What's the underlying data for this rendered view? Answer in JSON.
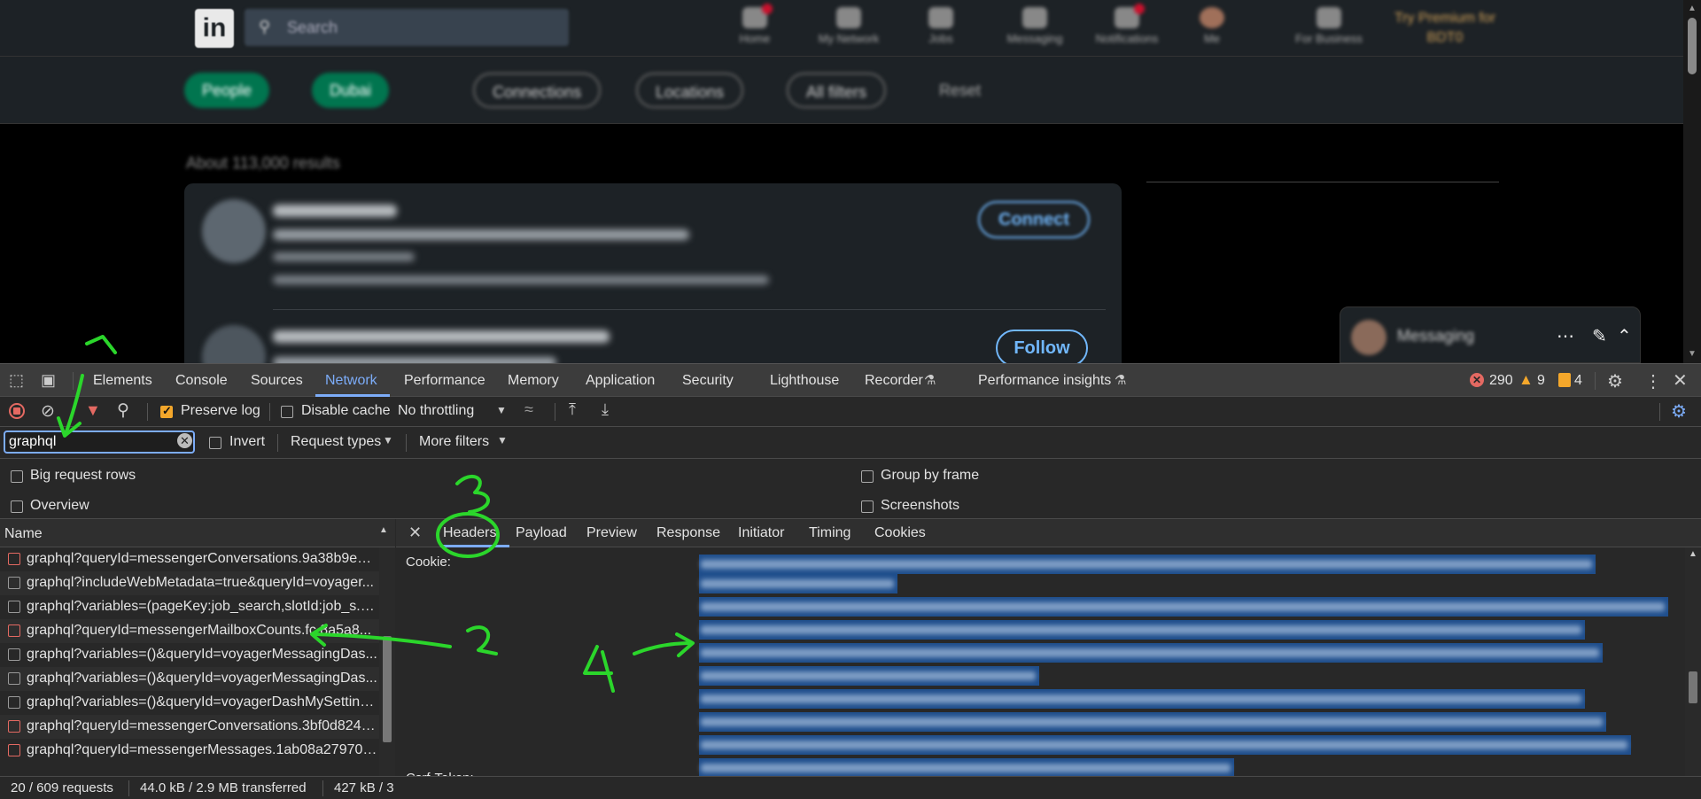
{
  "linkedin": {
    "logo_text": "in",
    "search_placeholder": "Search",
    "nav": [
      "Home",
      "My Network",
      "Jobs",
      "Messaging",
      "Notifications",
      "Me",
      "For Business"
    ],
    "premium": "Try Premium for BDT0",
    "filters": [
      "People",
      "Dubai",
      "Connections",
      "Locations",
      "All filters",
      "Reset"
    ],
    "results_count": "About 113,000 results",
    "connect_label": "Connect",
    "follow_label": "Follow",
    "messaging_widget": "Messaging"
  },
  "devtools": {
    "tabs": [
      "Elements",
      "Console",
      "Sources",
      "Network",
      "Performance",
      "Memory",
      "Application",
      "Security",
      "Lighthouse",
      "Recorder",
      "Performance insights"
    ],
    "active_tab": "Network",
    "errors": "290",
    "warnings": "9",
    "issues": "4",
    "toolbar": {
      "preserve_log": "Preserve log",
      "preserve_log_checked": true,
      "disable_cache": "Disable cache",
      "throttling": "No throttling"
    },
    "filter": {
      "value": "graphql",
      "invert": "Invert",
      "request_types": "Request types",
      "more_filters": "More filters"
    },
    "options": {
      "big_request_rows": "Big request rows",
      "overview": "Overview",
      "group_by_frame": "Group by frame",
      "screenshots": "Screenshots"
    },
    "list_header": "Name",
    "requests": [
      {
        "name": "graphql?queryId=messengerConversations.9a38b9e09...",
        "error": true
      },
      {
        "name": "graphql?includeWebMetadata=true&queryId=voyager...",
        "error": false
      },
      {
        "name": "graphql?variables=(pageKey:job_search,slotId:job_s...D...",
        "error": false
      },
      {
        "name": "graphql?queryId=messengerMailboxCounts.fc 8a5a8...",
        "error": true
      },
      {
        "name": "graphql?variables=()&queryId=voyagerMessagingDas...",
        "error": false
      },
      {
        "name": "graphql?variables=()&queryId=voyagerMessagingDas...",
        "error": false
      },
      {
        "name": "graphql?variables=()&queryId=voyagerDashMySetting...",
        "error": false
      },
      {
        "name": "graphql?queryId=messengerConversations.3bf0d8240...",
        "error": true
      },
      {
        "name": "graphql?queryId=messengerMessages.1ab08a279706...",
        "error": true
      }
    ],
    "detail_tabs": [
      "Headers",
      "Payload",
      "Preview",
      "Response",
      "Initiator",
      "Timing",
      "Cookies"
    ],
    "active_detail_tab": "Headers",
    "header_cookie": "Cookie:",
    "header_csrf": "Csrf-Token:",
    "status": {
      "requests": "20 / 609 requests",
      "transferred": "44.0 kB / 2.9 MB transferred",
      "resources": "427 kB / 3"
    }
  },
  "annotations": [
    "1",
    "2",
    "3",
    "4"
  ],
  "colors": {
    "accent_blue": "#7cacf8",
    "annotation_green": "#2bd62b",
    "error_red": "#e46962",
    "warning_orange": "#f4a72b",
    "selection_blue": "#1f4e8c"
  }
}
